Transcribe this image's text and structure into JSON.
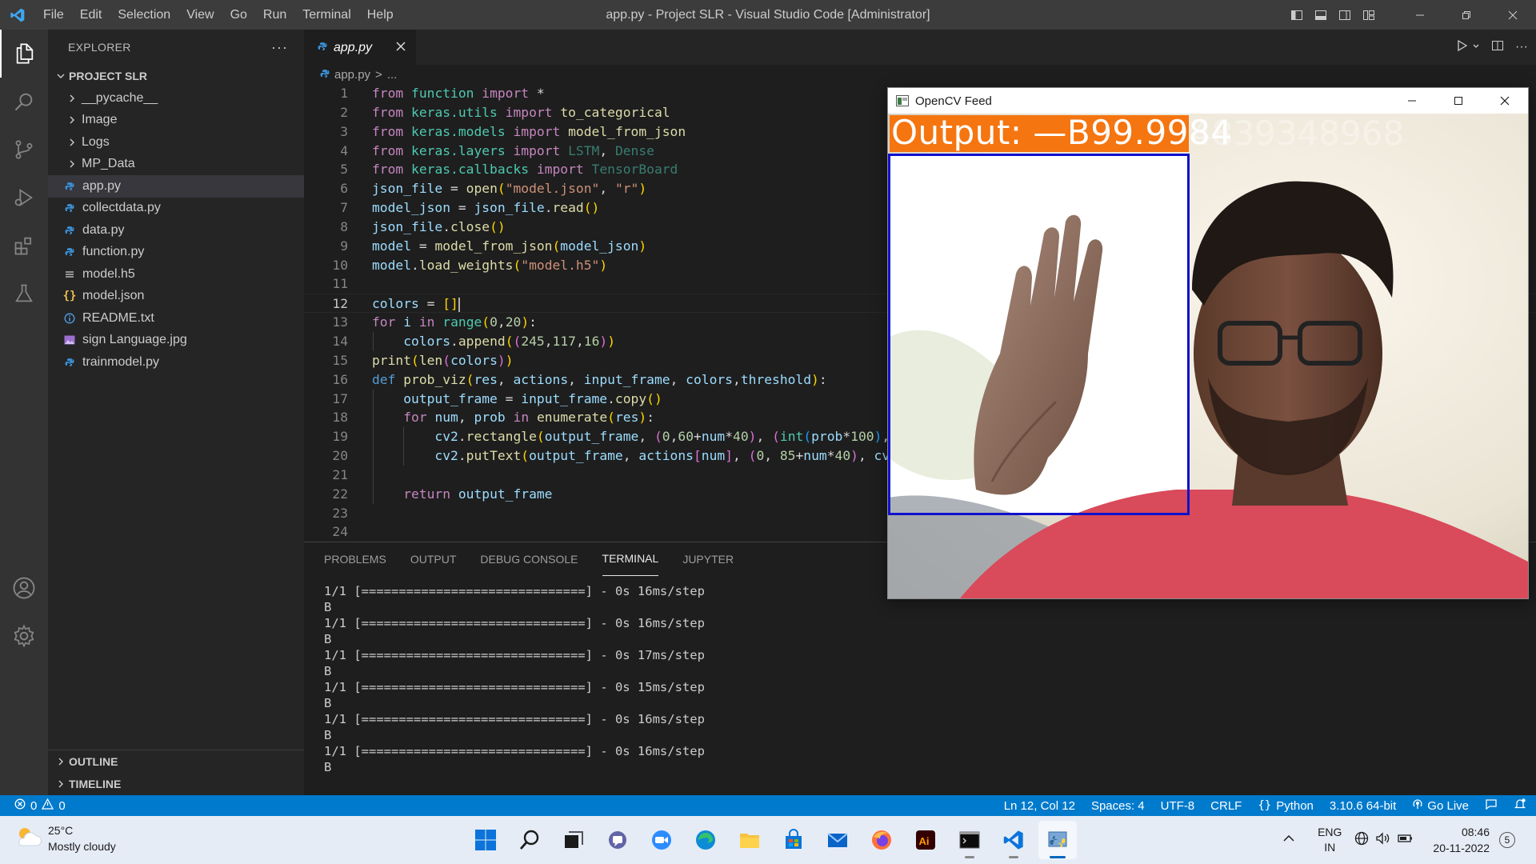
{
  "titlebar": {
    "menu": [
      "File",
      "Edit",
      "Selection",
      "View",
      "Go",
      "Run",
      "Terminal",
      "Help"
    ],
    "title": "app.py - Project SLR - Visual Studio Code [Administrator]"
  },
  "sidebar": {
    "header": "EXPLORER",
    "more": "···",
    "project": "PROJECT SLR",
    "items": [
      {
        "label": "__pycache__",
        "type": "folder"
      },
      {
        "label": "Image",
        "type": "folder"
      },
      {
        "label": "Logs",
        "type": "folder"
      },
      {
        "label": "MP_Data",
        "type": "folder"
      },
      {
        "label": "app.py",
        "type": "python",
        "selected": true
      },
      {
        "label": "collectdata.py",
        "type": "python"
      },
      {
        "label": "data.py",
        "type": "python"
      },
      {
        "label": "function.py",
        "type": "python"
      },
      {
        "label": "model.h5",
        "type": "file-lines"
      },
      {
        "label": "model.json",
        "type": "json"
      },
      {
        "label": "README.txt",
        "type": "info"
      },
      {
        "label": "sign Language.jpg",
        "type": "image"
      },
      {
        "label": "trainmodel.py",
        "type": "python"
      }
    ],
    "outline": "OUTLINE",
    "timeline": "TIMELINE"
  },
  "editor": {
    "tab": "app.py",
    "breadcrumb": [
      "app.py",
      ">",
      "..."
    ],
    "current_line": 12,
    "line_numbers": [
      "1",
      "2",
      "3",
      "4",
      "5",
      "6",
      "7",
      "8",
      "9",
      "10",
      "11",
      "12",
      "13",
      "14",
      "15",
      "16",
      "17",
      "18",
      "19",
      "20",
      "21",
      "22",
      "23",
      "24"
    ]
  },
  "panel": {
    "tabs": [
      "PROBLEMS",
      "OUTPUT",
      "DEBUG CONSOLE",
      "TERMINAL",
      "JUPYTER"
    ],
    "active_tab": "TERMINAL",
    "terminal_lines": [
      "1/1 [==============================] - 0s 16ms/step",
      "B",
      "1/1 [==============================] - 0s 16ms/step",
      "B",
      "1/1 [==============================] - 0s 17ms/step",
      "B",
      "1/1 [==============================] - 0s 15ms/step",
      "B",
      "1/1 [==============================] - 0s 16ms/step",
      "B",
      "1/1 [==============================] - 0s 16ms/step",
      "B"
    ]
  },
  "statusbar": {
    "errors": "0",
    "warnings": "0",
    "position": "Ln 12, Col 12",
    "spaces": "Spaces: 4",
    "encoding": "UTF-8",
    "eol": "CRLF",
    "language": "Python",
    "interpreter": "3.10.6 64-bit",
    "golive": "Go Live"
  },
  "cv_window": {
    "title": "OpenCV Feed",
    "output_text": "Output: —B99.9984",
    "output_overflow": "4839348968"
  },
  "taskbar": {
    "temperature": "25°C",
    "weather": "Mostly cloudy",
    "lang1": "ENG",
    "lang2": "IN",
    "time": "08:46",
    "date": "20-11-2022",
    "notifications": "5"
  },
  "colors": {
    "accent": "#007acc",
    "cv_bar": "#f57510",
    "cv_roi": "#1111cc"
  }
}
